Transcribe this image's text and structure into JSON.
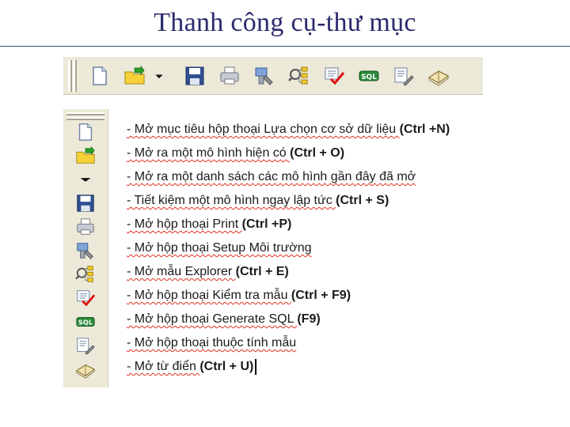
{
  "slide": {
    "title": "Thanh công cụ-thư mục"
  },
  "toolbar": {
    "icons": [
      "new-icon",
      "open-folder-icon",
      "dropdown-arrow-icon",
      "save-icon",
      "print-icon",
      "setup-environment-icon",
      "explorer-icon",
      "check-model-icon",
      "generate-sql-icon",
      "model-properties-icon",
      "dictionary-icon"
    ]
  },
  "items": [
    {
      "text": "- Mở mục tiêu hộp thoại Lựa chọn cơ sở dữ liệu ",
      "shortcut": "(Ctrl +N)"
    },
    {
      "text": "- Mở ra một mô hình hiện có ",
      "shortcut": "(Ctrl + O)"
    },
    {
      "text": "- Mở ra một danh sách các mô hình gần đây đã mở",
      "shortcut": ""
    },
    {
      "text": "- Tiết kiệm một mô hình ngay lập tức ",
      "shortcut": "(Ctrl + S)"
    },
    {
      "text": "- Mở hộp thoại Print ",
      "shortcut": "(Ctrl +P)"
    },
    {
      "text": "- Mở hộp thoại Setup Môi trường",
      "shortcut": ""
    },
    {
      "text": "- Mở mẫu Explorer ",
      "shortcut": "(Ctrl + E)"
    },
    {
      "text": "- Mở hộp thoại Kiểm tra mẫu ",
      "shortcut": "(Ctrl + F9)"
    },
    {
      "text": "- Mở hộp thoại Generate SQL ",
      "shortcut": "(F9)"
    },
    {
      "text": "- Mở hộp thoại thuộc tính mẫu",
      "shortcut": ""
    },
    {
      "text": "- Mở từ điển ",
      "shortcut": "(Ctrl + U)"
    }
  ]
}
